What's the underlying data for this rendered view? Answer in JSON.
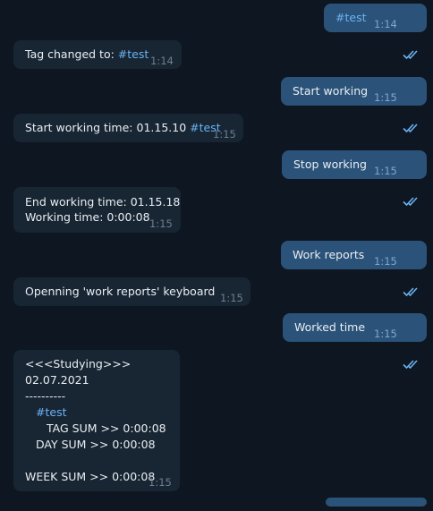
{
  "messages": [
    {
      "dir": "out",
      "text": "",
      "tag": "#test",
      "time": "1:14"
    },
    {
      "dir": "in",
      "text": "Tag changed to: ",
      "tag": "#test",
      "time": "1:14"
    },
    {
      "dir": "out",
      "text": "Start working",
      "time": "1:15"
    },
    {
      "dir": "in",
      "text": "Start working time: 01.15.10 ",
      "tag": "#test",
      "time": "1:15"
    },
    {
      "dir": "out",
      "text": "Stop working",
      "time": "1:15"
    },
    {
      "dir": "in",
      "lines": [
        "End working time: 01.15.18",
        "Working time: 0:00:08"
      ],
      "time": "1:15"
    },
    {
      "dir": "out",
      "text": "Work reports",
      "time": "1:15"
    },
    {
      "dir": "in",
      "text": "Openning 'work reports' keyboard",
      "time": "1:15"
    },
    {
      "dir": "out",
      "text": "Worked time",
      "time": "1:15"
    },
    {
      "dir": "in",
      "report": {
        "header": "<<<Studying>>>",
        "date": "02.07.2021",
        "separator": "----------",
        "tag": "#test",
        "tag_sum": "TAG SUM >> 0:00:08",
        "day_sum": "DAY SUM >> 0:00:08",
        "week_sum": "WEEK SUM >> 0:00:08"
      },
      "time": "1:15"
    }
  ],
  "colors": {
    "background": "#0e1621",
    "incoming_bubble": "#182533",
    "outgoing_bubble": "#2b5278",
    "hashtag": "#6ab3f3",
    "read_check": "#6ab3f3"
  },
  "icons": {
    "read_receipt": "double-check-icon"
  }
}
